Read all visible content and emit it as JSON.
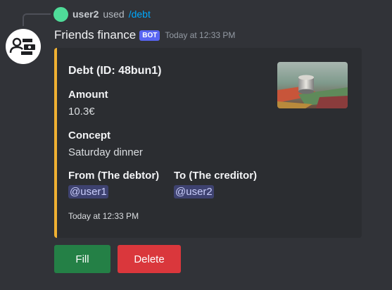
{
  "reply": {
    "user": "user2",
    "used_text": "used",
    "command": "/debt"
  },
  "message": {
    "author": "Friends finance",
    "bot_tag": "BOT",
    "timestamp": "Today at 12:33 PM"
  },
  "embed": {
    "accent_color": "#f0b132",
    "title": "Debt (ID: 48bun1)",
    "fields": [
      {
        "name": "Amount",
        "value": "10.3€"
      },
      {
        "name": "Concept",
        "value": "Saturday dinner"
      },
      {
        "name": "From (The debtor)",
        "value": "@user1"
      },
      {
        "name": "To (The creditor)",
        "value": "@user2"
      }
    ],
    "footer": "Today at 12:33 PM"
  },
  "buttons": {
    "fill": "Fill",
    "delete": "Delete"
  },
  "icons": {
    "avatar": "person-with-money-icon",
    "thumbnail": "coins-and-banknotes-image"
  }
}
